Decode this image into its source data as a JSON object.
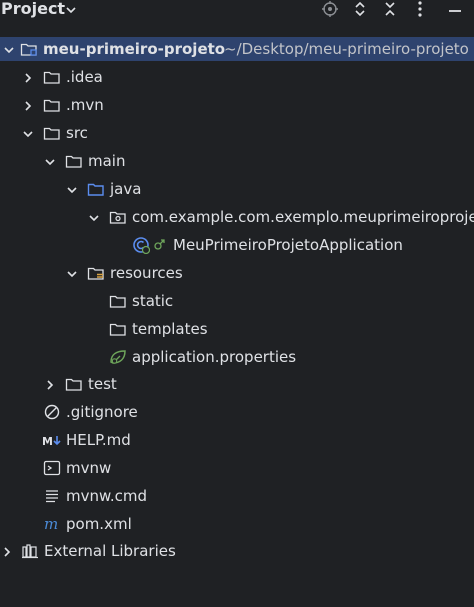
{
  "header": {
    "title": "Project",
    "icons": [
      "locate-icon",
      "expand-all-icon",
      "collapse-all-icon",
      "more-icon"
    ]
  },
  "tree": {
    "root": {
      "label": "meu-primeiro-projeto",
      "path": "~/Desktop/meu-primeiro-projeto"
    },
    "idea": {
      "label": ".idea"
    },
    "mvn": {
      "label": ".mvn"
    },
    "src": {
      "label": "src"
    },
    "main": {
      "label": "main"
    },
    "java": {
      "label": "java"
    },
    "package": {
      "label": "com.example.com.exemplo.meuprimeiroprojeto"
    },
    "app_class": {
      "label": "MeuPrimeiroProjetoApplication"
    },
    "resources": {
      "label": "resources"
    },
    "static": {
      "label": "static"
    },
    "templates": {
      "label": "templates"
    },
    "app_props": {
      "label": "application.properties"
    },
    "test": {
      "label": "test"
    },
    "gitignore": {
      "label": ".gitignore"
    },
    "help": {
      "label": "HELP.md"
    },
    "mvnw": {
      "label": "mvnw"
    },
    "mvnw_cmd": {
      "label": "mvnw.cmd"
    },
    "pom": {
      "label": "pom.xml"
    },
    "external": {
      "label": "External Libraries"
    }
  },
  "colors": {
    "background": "#1f2124",
    "selection": "#2e436e",
    "folder_blue": "#5b8def",
    "spring_green": "#6ea55b",
    "maven_blue": "#4b8bd8"
  }
}
